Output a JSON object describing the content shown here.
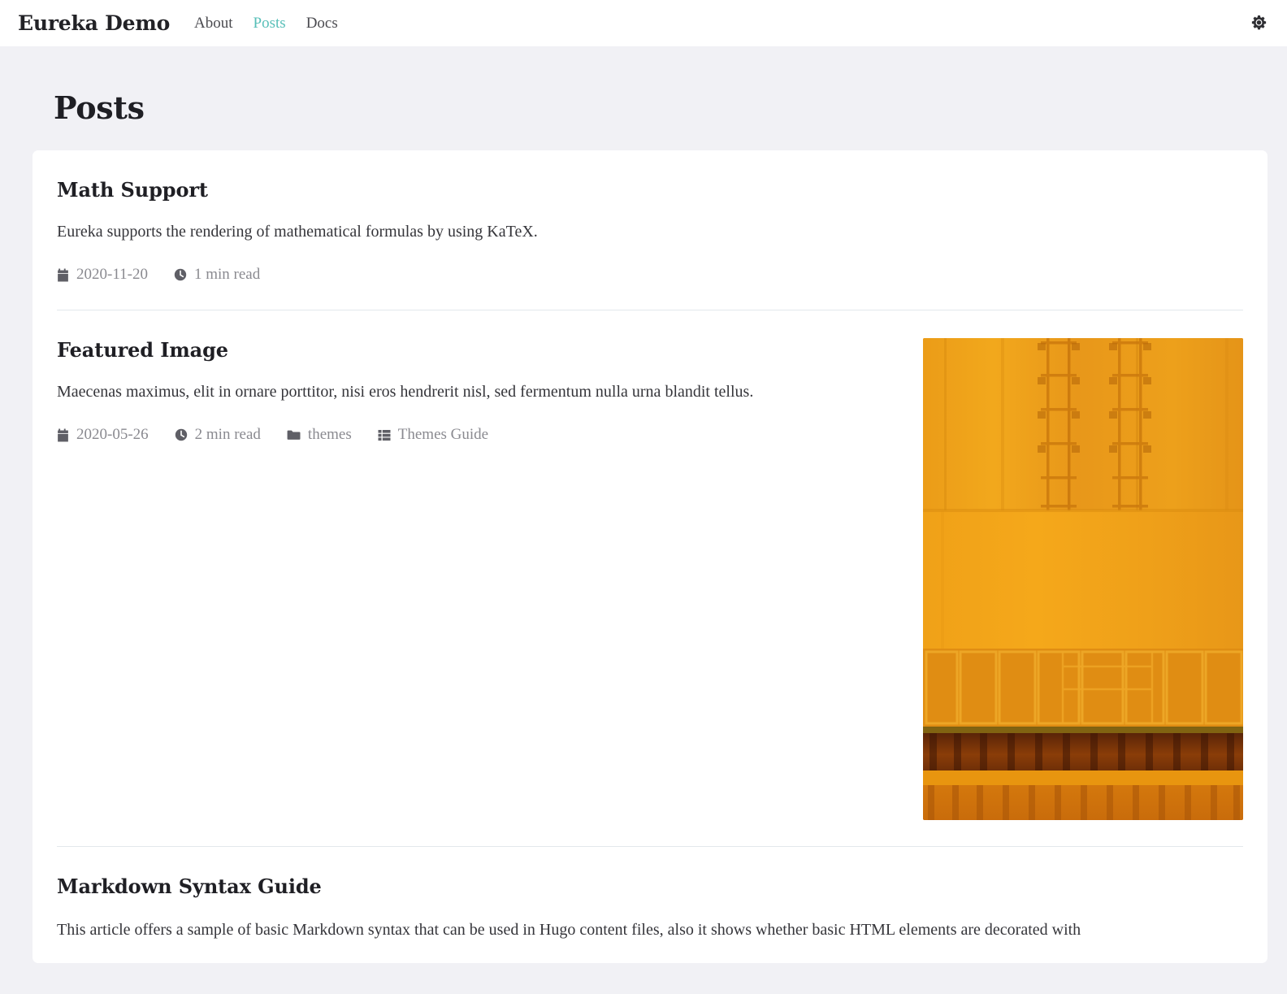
{
  "header": {
    "brand": "Eureka Demo",
    "nav": [
      {
        "label": "About",
        "active": false
      },
      {
        "label": "Posts",
        "active": true
      },
      {
        "label": "Docs",
        "active": false
      }
    ],
    "theme_toggle_icon": "sun-gear-icon",
    "accent_color": "#57bfb8",
    "background": "#ffffff"
  },
  "page": {
    "title": "Posts",
    "background": "#f1f1f5",
    "card_background": "#ffffff"
  },
  "posts": [
    {
      "title": "Math Support",
      "summary": "Eureka supports the rendering of mathematical formulas by using KaTeX.",
      "meta": [
        {
          "icon": "calendar-icon",
          "label": "2020-11-20"
        },
        {
          "icon": "clock-icon",
          "label": "1 min read"
        }
      ],
      "has_image": false
    },
    {
      "title": "Featured Image",
      "summary": "Maecenas maximus, elit in ornare porttitor, nisi eros hendrerit nisl, sed fermentum nulla urna blandit tellus.",
      "meta": [
        {
          "icon": "calendar-icon",
          "label": "2020-05-26"
        },
        {
          "icon": "clock-icon",
          "label": "2 min read"
        },
        {
          "icon": "folder-icon",
          "label": "themes"
        },
        {
          "icon": "list-icon",
          "label": "Themes Guide"
        }
      ],
      "has_image": true,
      "image_alt": "Orange shipping containers stacked, close-up"
    },
    {
      "title": "Markdown Syntax Guide",
      "summary": "This article offers a sample of basic Markdown syntax that can be used in Hugo content files, also it shows whether basic HTML elements are decorated with",
      "meta": [],
      "has_image": false
    }
  ]
}
